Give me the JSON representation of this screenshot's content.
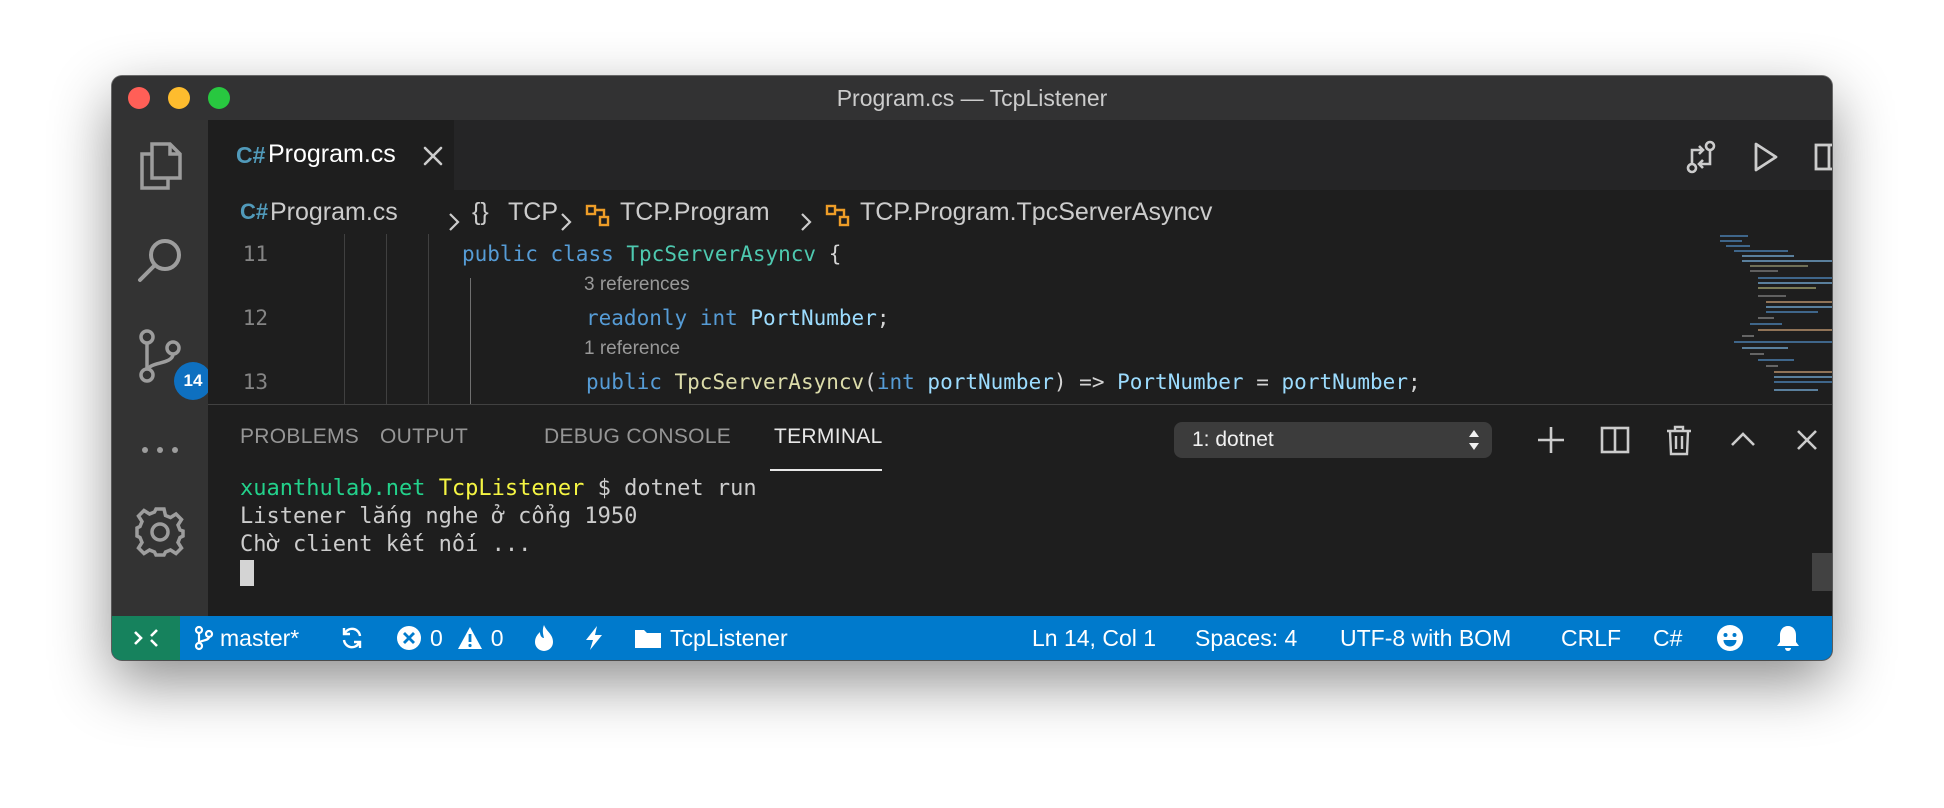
{
  "window": {
    "title": "Program.cs — TcpListener"
  },
  "activity_bar": {
    "scm_badge": "14"
  },
  "tab": {
    "lang_icon": "C#",
    "title": "Program.cs"
  },
  "breadcrumb": {
    "file_icon": "C#",
    "file": "Program.cs",
    "namespace_icon": "{}",
    "namespace": "TCP",
    "class": "TCP.Program",
    "member": "TCP.Program.TpcServerAsyncv"
  },
  "editor": {
    "lines": [
      {
        "number": "11",
        "tokens": [
          "public",
          "class",
          "TpcServerAsyncv",
          "{"
        ]
      },
      {
        "lens": "3 references",
        "number": "12",
        "tokens": [
          "readonly",
          "int",
          "PortNumber",
          ";"
        ]
      },
      {
        "lens": "1 reference",
        "number": "13",
        "tokens": [
          "public",
          "TpcServerAsyncv",
          "(",
          "int",
          "portNumber",
          ")",
          "=>",
          "PortNumber",
          "=",
          "portNumber",
          ";"
        ]
      }
    ]
  },
  "panel": {
    "tabs": [
      "PROBLEMS",
      "OUTPUT",
      "DEBUG CONSOLE",
      "TERMINAL"
    ],
    "active_tab": "TERMINAL",
    "terminal_select": "1: dotnet",
    "terminal": {
      "host": "xuanthulab.net",
      "dir": "TcpListener",
      "prompt": "$",
      "command": "dotnet run",
      "output": [
        "Listener lắng nghe ở cổng 1950",
        "Chờ client kết nối ..."
      ]
    }
  },
  "status_bar": {
    "branch": "master*",
    "errors": "0",
    "warnings": "0",
    "folder": "TcpListener",
    "position": "Ln 14, Col 1",
    "spaces": "Spaces: 4",
    "encoding": "UTF-8 with BOM",
    "eol": "CRLF",
    "language": "C#"
  },
  "colors": {
    "status_bar": "#007acc",
    "remote_indicator": "#16825d",
    "badge": "#0e70c0",
    "editor_bg": "#1e1e1e"
  },
  "icons": [
    "files-icon",
    "search-icon",
    "source-control-icon",
    "more-icon",
    "gear-icon",
    "compare-changes-icon",
    "run-icon",
    "split-editor-icon",
    "ellipsis-icon",
    "plus-icon",
    "trash-icon",
    "chevron-up-icon",
    "close-icon",
    "remote-icon",
    "branch-icon",
    "sync-icon",
    "error-icon",
    "warning-icon",
    "flame-icon",
    "lightning-icon",
    "folder-icon",
    "smiley-icon",
    "bell-icon"
  ]
}
